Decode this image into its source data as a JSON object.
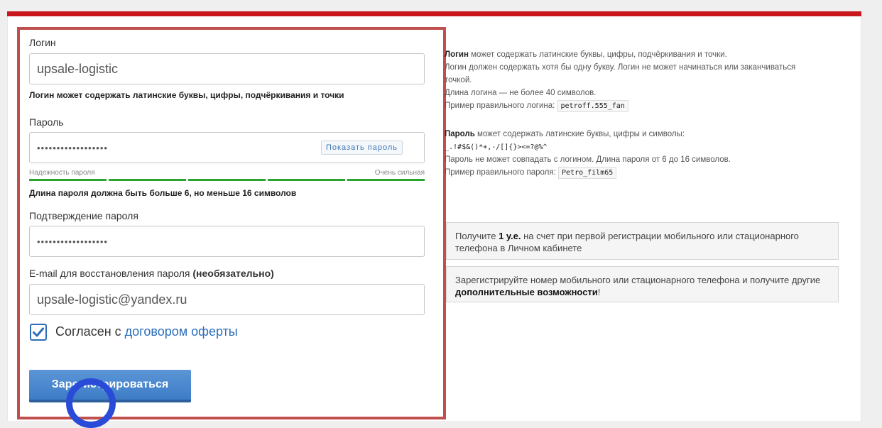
{
  "form": {
    "login_label": "Логин",
    "login_value": "upsale-logistic",
    "login_hint": "Логин может содержать латинские буквы, цифры, подчёркивания и точки",
    "password_label": "Пароль",
    "password_value": "••••••••••••••••••",
    "show_password": "Показать пароль",
    "strength_label": "Надежность пароля",
    "strength_value": "Очень сильная",
    "strength_level": 1.0,
    "password_hint": "Длина пароля должна быть больше 6, но меньше 16 символов",
    "confirm_label": "Подтверждение пароля",
    "confirm_value": "••••••••••••••••••",
    "email_label": "E-mail для восстановления пароля",
    "email_optional": "(необязательно)",
    "email_value": "upsale-logistic@yandex.ru",
    "agree_checked": true,
    "agree_text": "Согласен с ",
    "agree_link": "договором оферты",
    "submit": "Зарегистрироваться"
  },
  "rules": {
    "login_bold": "Логин",
    "login_1": " может содержать латинские буквы, цифры, подчёркивания и точки.",
    "login_2": "Логин должен содержать хотя бы одну букву. Логин не может начинаться или заканчиваться",
    "login_3": "точкой.",
    "login_4": "Длина логина — не более 40 символов.",
    "login_example_label": "Пример правильного логина:",
    "login_example": "petroff.555_fan",
    "pw_bold": "Пароль",
    "pw_1": " может содержать латинские буквы, цифры и символы:",
    "pw_symbols": "_.!#$&()*+,-/[]{}><=?@%^",
    "pw_2": "Пароль не может совпадать с логином. Длина пароля от 6 до 16 символов.",
    "pw_example_label": "Пример правильного пароля:",
    "pw_example": "Petro_film65"
  },
  "info": {
    "box1_pre": "Получите ",
    "box1_bold": "1 у.е.",
    "box1_post": " на счет при первой регистрации мобильного или стационарного телефона в Личном кабинете",
    "box2_pre": "Зарегистрируйте номер мобильного или стационарного телефона и получите другие ",
    "box2_bold": "дополнительные возможности",
    "box2_post": "!"
  },
  "colors": {
    "accent_red": "#c8171d",
    "highlight": "#c0504d",
    "strength_green": "#2aa52f",
    "link_blue": "#2a6ebb",
    "button_blue": "#4a87cd",
    "cursor_ring": "#2a4bd8"
  },
  "icons": {
    "checkbox": "check-icon"
  }
}
